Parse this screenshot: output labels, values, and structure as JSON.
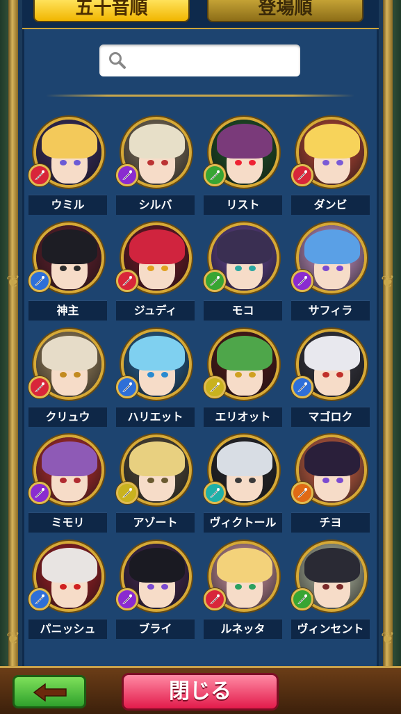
{
  "tabs": [
    {
      "label": "五十音順",
      "active": true
    },
    {
      "label": "登場順",
      "active": false
    }
  ],
  "search": {
    "value": "",
    "icon": "search-icon"
  },
  "characters": [
    {
      "name": "ウミル",
      "attribute": "red",
      "hair": "#f3c95a",
      "bg": "#3c2f6a",
      "eye": "#6b5bd6"
    },
    {
      "name": "シルバ",
      "attribute": "purple",
      "hair": "#e7dfc8",
      "bg": "#8a7b64",
      "eye": "#b33"
    },
    {
      "name": "リスト",
      "attribute": "green",
      "hair": "#7a3a7a",
      "bg": "#1f5a2a",
      "eye": "#e23"
    },
    {
      "name": "ダンビ",
      "attribute": "red",
      "hair": "#f7d35a",
      "bg": "#c94d3a",
      "eye": "#7a5bd6"
    },
    {
      "name": "神主",
      "attribute": "blue",
      "hair": "#1d1d24",
      "bg": "#6b2030",
      "eye": "#2b2b2b"
    },
    {
      "name": "ジュディ",
      "attribute": "red",
      "hair": "#d0243e",
      "bg": "#7a1a2a",
      "eye": "#e0a020"
    },
    {
      "name": "モコ",
      "attribute": "green",
      "hair": "#3a2f52",
      "bg": "#6c4aa0",
      "eye": "#2aa6a0"
    },
    {
      "name": "サフィラ",
      "attribute": "purple",
      "hair": "#5aa0e6",
      "bg": "#d7a0d8",
      "eye": "#7a4ad0"
    },
    {
      "name": "クリュウ",
      "attribute": "red",
      "hair": "#e6dcc8",
      "bg": "#a89066",
      "eye": "#c38a20"
    },
    {
      "name": "ハリエット",
      "attribute": "blue",
      "hair": "#7fd0f0",
      "bg": "#2a6aa0",
      "eye": "#2a8ad0"
    },
    {
      "name": "エリオット",
      "attribute": "yellow",
      "hair": "#4ea64a",
      "bg": "#5a1a1a",
      "eye": "#d0a020"
    },
    {
      "name": "マゴロク",
      "attribute": "blue",
      "hair": "#e8e8ee",
      "bg": "#3a3a46",
      "eye": "#c0302a"
    },
    {
      "name": "ミモリ",
      "attribute": "purple",
      "hair": "#8e5ab6",
      "bg": "#c83030",
      "eye": "#b02a30"
    },
    {
      "name": "アゾート",
      "attribute": "yellow",
      "hair": "#e8d080",
      "bg": "#5a5040",
      "eye": "#6a5a30"
    },
    {
      "name": "ヴィクトール",
      "attribute": "cyan",
      "hair": "#d8dde4",
      "bg": "#2a2a30",
      "eye": "#3a3a3a"
    },
    {
      "name": "チヨ",
      "attribute": "orange",
      "hair": "#2a1f3a",
      "bg": "#e06a4a",
      "eye": "#7a4ad0"
    },
    {
      "name": "パニッシュ",
      "attribute": "blue",
      "hair": "#e8e4e2",
      "bg": "#b02028",
      "eye": "#d02020"
    },
    {
      "name": "ブライ",
      "attribute": "purple",
      "hair": "#1a1a22",
      "bg": "#4a2a5a",
      "eye": "#7a4ad0"
    },
    {
      "name": "ルネッタ",
      "attribute": "red",
      "hair": "#f3d27a",
      "bg": "#e0a0b0",
      "eye": "#2aa060"
    },
    {
      "name": "ヴィンセント",
      "attribute": "green",
      "hair": "#2a2a34",
      "bg": "#c0c8b0",
      "eye": "#7a2a2a"
    }
  ],
  "attribute_colors": {
    "red": "#d8263a",
    "purple": "#8a2bd0",
    "green": "#38a533",
    "blue": "#2e6fd8",
    "yellow": "#c9b21f",
    "cyan": "#1fb0a8",
    "orange": "#e06a15"
  },
  "footer": {
    "back_icon": "arrow-left-icon",
    "close_label": "閉じる"
  }
}
